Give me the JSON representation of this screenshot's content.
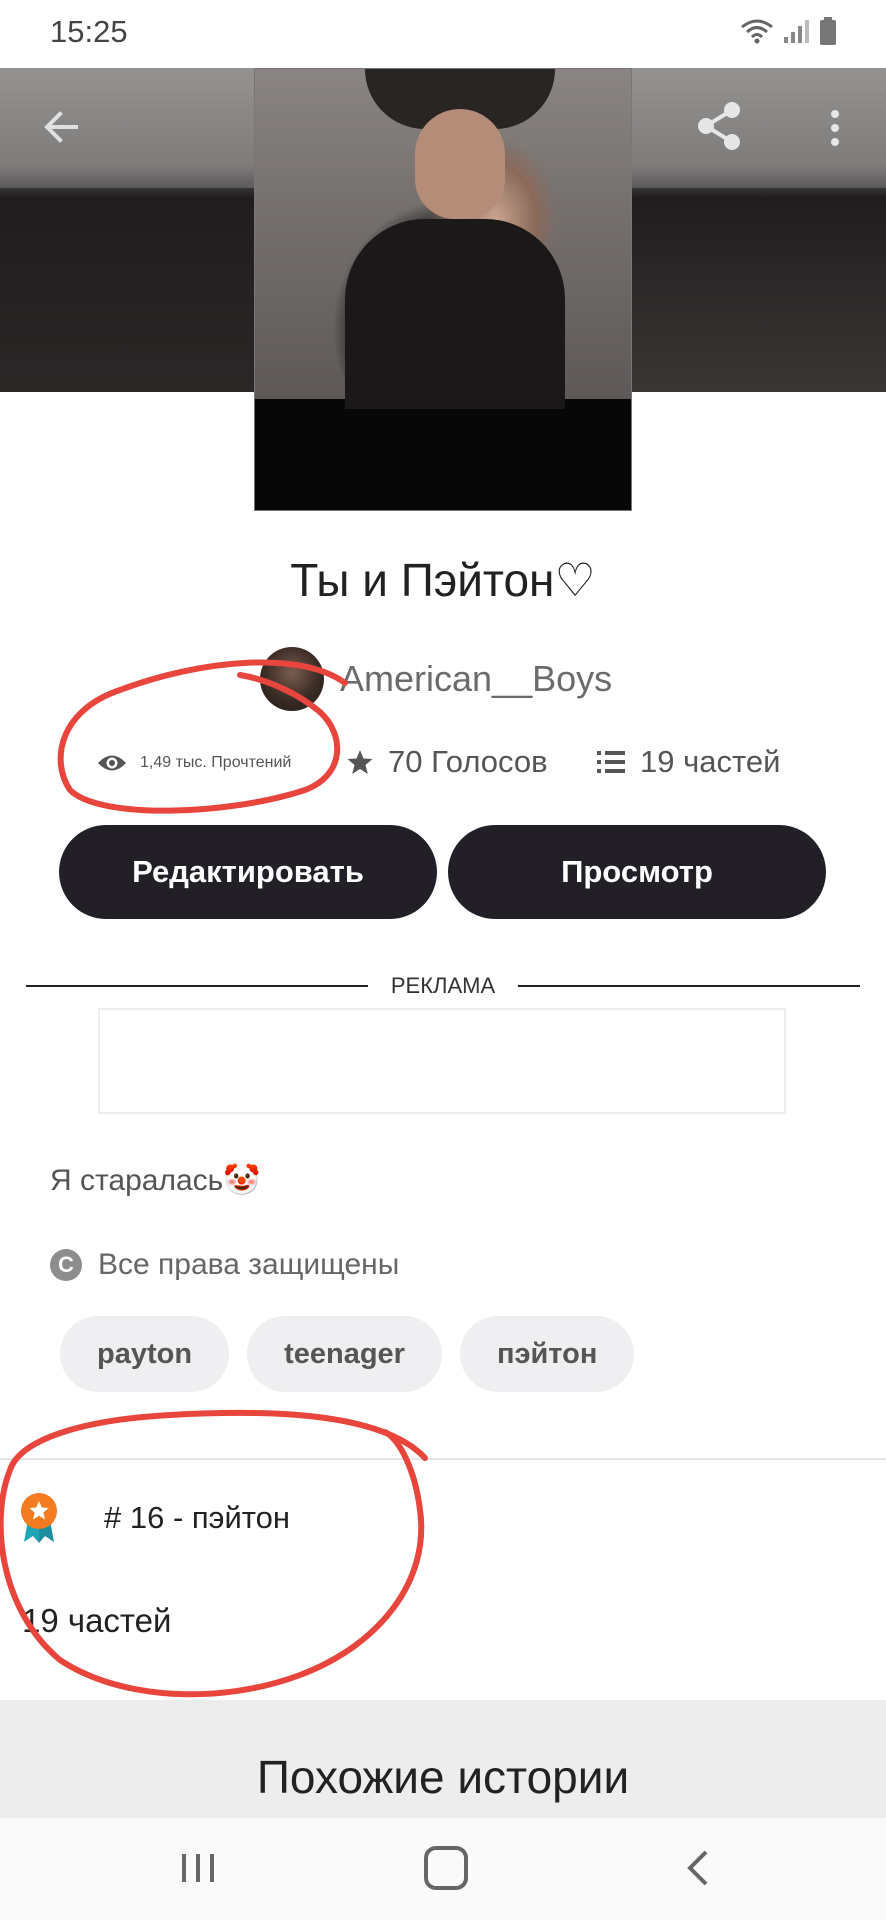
{
  "status_bar": {
    "time": "15:25"
  },
  "story": {
    "title": "Ты и Пэйтон♡",
    "author": "American__Boys",
    "reads": "1,49 тыс. Прочтений",
    "votes": "70 Голосов",
    "parts": "19 частей"
  },
  "actions": {
    "edit_label": "Редактировать",
    "view_label": "Просмотр"
  },
  "ad": {
    "label": "РЕКЛАМА"
  },
  "description": "Я старалась🤡",
  "copyright": "Все права защищены",
  "tags": [
    "payton",
    "teenager",
    "пэйтон"
  ],
  "ranking": {
    "text": "# 16 - пэйтон"
  },
  "parts_count": "19 частей",
  "similar": {
    "title": "Похожие истории"
  },
  "icons": {
    "back": "arrow-back-icon",
    "share": "share-icon",
    "more": "more-vert-icon",
    "views": "eye-icon",
    "votes": "star-icon",
    "parts": "list-icon",
    "copyright": "copyright-icon",
    "rank": "award-badge-icon"
  },
  "colors": {
    "button_bg": "#222026",
    "tag_bg": "#efeff1",
    "annotation": "#e8453c",
    "badge": "#f47b20"
  }
}
